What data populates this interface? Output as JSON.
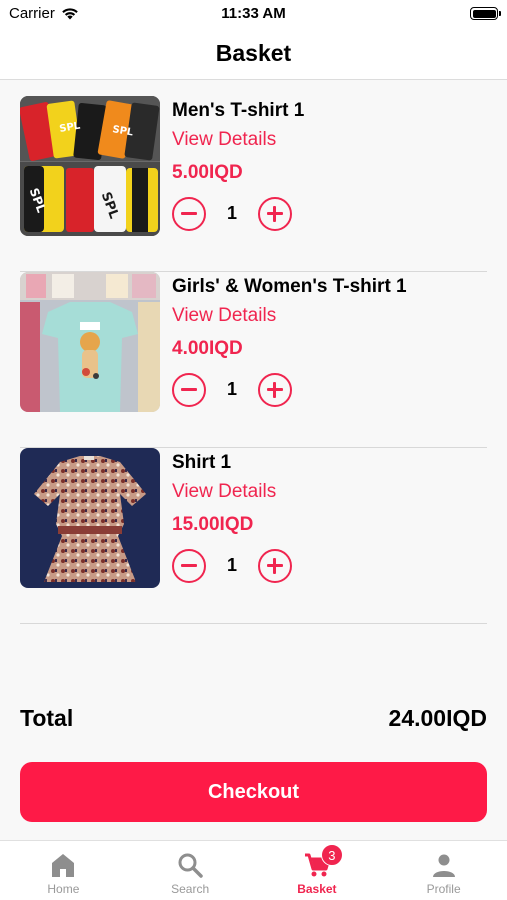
{
  "status_bar": {
    "carrier": "Carrier",
    "time": "11:33 AM"
  },
  "header": {
    "title": "Basket"
  },
  "items": [
    {
      "name": "Men's T-shirt 1",
      "details_label": "View Details",
      "price": "5.00IQD",
      "quantity": "1",
      "image": "photo of stacked printed t-shirts"
    },
    {
      "name": "Girls' & Women's T-shirt 1",
      "details_label": "View Details",
      "price": "4.00IQD",
      "quantity": "1",
      "image": "photo of light blue graphic t-shirt"
    },
    {
      "name": "Shirt 1",
      "details_label": "View Details",
      "price": "15.00IQD",
      "quantity": "1",
      "image": "photo of patterned shirt dress"
    }
  ],
  "summary": {
    "total_label": "Total",
    "total_value": "24.00IQD"
  },
  "checkout": {
    "label": "Checkout"
  },
  "tabs": [
    {
      "label": "Home",
      "icon": "home-icon"
    },
    {
      "label": "Search",
      "icon": "search-icon"
    },
    {
      "label": "Basket",
      "icon": "cart-icon",
      "badge": "3",
      "active": true
    },
    {
      "label": "Profile",
      "icon": "person-icon"
    }
  ],
  "colors": {
    "accent": "#f0254f",
    "button": "#fe1a47",
    "background": "#f8f8f8"
  }
}
